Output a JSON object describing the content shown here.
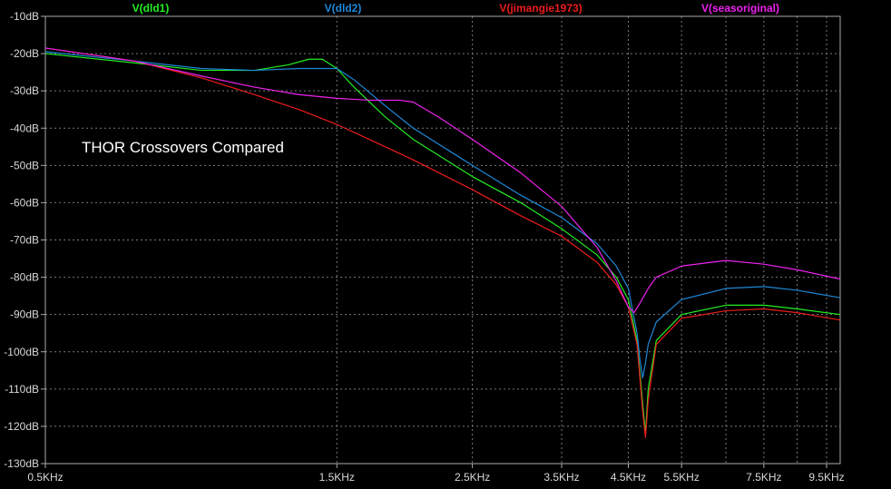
{
  "chart_data": {
    "type": "line",
    "title": "",
    "xlabel": "",
    "ylabel": "",
    "annotation": "THOR Crossovers Compared",
    "x_scale": "log",
    "xlim": [
      500,
      10000
    ],
    "ylim": [
      -130,
      -10
    ],
    "grid": true,
    "legend_position": "top",
    "x_ticks": [
      {
        "value": 500,
        "label": "0.5KHz"
      },
      {
        "value": 1500,
        "label": "1.5KHz"
      },
      {
        "value": 2500,
        "label": "2.5KHz"
      },
      {
        "value": 3500,
        "label": "3.5KHz"
      },
      {
        "value": 4500,
        "label": "4.5KHz"
      },
      {
        "value": 5500,
        "label": "5.5KHz"
      },
      {
        "value": 7500,
        "label": "7.5KHz"
      },
      {
        "value": 9500,
        "label": "9.5KHz"
      }
    ],
    "y_ticks": [
      {
        "value": -10,
        "label": "-10dB"
      },
      {
        "value": -20,
        "label": "-20dB"
      },
      {
        "value": -30,
        "label": "-30dB"
      },
      {
        "value": -40,
        "label": "-40dB"
      },
      {
        "value": -50,
        "label": "-50dB"
      },
      {
        "value": -60,
        "label": "-60dB"
      },
      {
        "value": -70,
        "label": "-70dB"
      },
      {
        "value": -80,
        "label": "-80dB"
      },
      {
        "value": -90,
        "label": "-90dB"
      },
      {
        "value": -100,
        "label": "-100dB"
      },
      {
        "value": -110,
        "label": "-110dB"
      },
      {
        "value": -120,
        "label": "-120dB"
      },
      {
        "value": -130,
        "label": "-130dB"
      }
    ],
    "series": [
      {
        "name": "V(dld1)",
        "color": "#22ee22",
        "x": [
          500,
          700,
          900,
          1100,
          1250,
          1350,
          1420,
          1500,
          1600,
          1800,
          2000,
          2500,
          3000,
          3500,
          4000,
          4300,
          4500,
          4650,
          4750,
          4800,
          4850,
          5000,
          5500,
          6500,
          7500,
          8500,
          10000
        ],
        "y": [
          -20,
          -22.5,
          -24.5,
          -24.5,
          -23,
          -21.5,
          -21.5,
          -24,
          -29,
          -37,
          -43,
          -53,
          -60,
          -67,
          -74,
          -80,
          -86,
          -97,
          -114,
          -122,
          -110,
          -97,
          -90,
          -87.5,
          -87.5,
          -88.5,
          -90
        ]
      },
      {
        "name": "V(dld2)",
        "color": "#1e88d8",
        "x": [
          500,
          700,
          900,
          1100,
          1300,
          1500,
          1600,
          1800,
          2000,
          2500,
          3000,
          3500,
          4000,
          4300,
          4500,
          4650,
          4700,
          4750,
          4800,
          4850,
          5000,
          5500,
          6500,
          7500,
          8500,
          10000
        ],
        "y": [
          -19.5,
          -22,
          -24,
          -24.5,
          -24,
          -24,
          -27,
          -34,
          -40,
          -50,
          -58,
          -64,
          -71,
          -77,
          -83,
          -95,
          -102,
          -107,
          -103,
          -98,
          -92,
          -86,
          -83,
          -82.5,
          -83.5,
          -85.5
        ]
      },
      {
        "name": "V(jimangie1973)",
        "color": "#ee1c1c",
        "x": [
          500,
          700,
          900,
          1100,
          1300,
          1500,
          1800,
          2000,
          2500,
          3000,
          3500,
          4000,
          4300,
          4500,
          4650,
          4750,
          4800,
          4850,
          5000,
          5500,
          6500,
          7500,
          8500,
          10000
        ],
        "y": [
          -18.5,
          -22,
          -26.5,
          -31,
          -35,
          -39,
          -45,
          -48.5,
          -56.5,
          -63.5,
          -69,
          -76,
          -82,
          -88,
          -98,
          -116,
          -123,
          -113,
          -98,
          -91,
          -89,
          -88.5,
          -89.5,
          -91.5
        ]
      },
      {
        "name": "V(seasoriginal)",
        "color": "#ee22ee",
        "x": [
          500,
          700,
          900,
          1100,
          1300,
          1500,
          1700,
          1900,
          2000,
          2200,
          2500,
          3000,
          3500,
          4000,
          4300,
          4500,
          4600,
          4700,
          4850,
          5000,
          5500,
          6500,
          7500,
          8500,
          10000
        ],
        "y": [
          -18.5,
          -22,
          -26,
          -29,
          -31,
          -32,
          -32.5,
          -32.5,
          -33,
          -37,
          -43,
          -52,
          -61,
          -72,
          -81,
          -88,
          -89.5,
          -87,
          -83,
          -80,
          -77,
          -75.5,
          -76.5,
          -78,
          -80.5
        ]
      }
    ]
  }
}
